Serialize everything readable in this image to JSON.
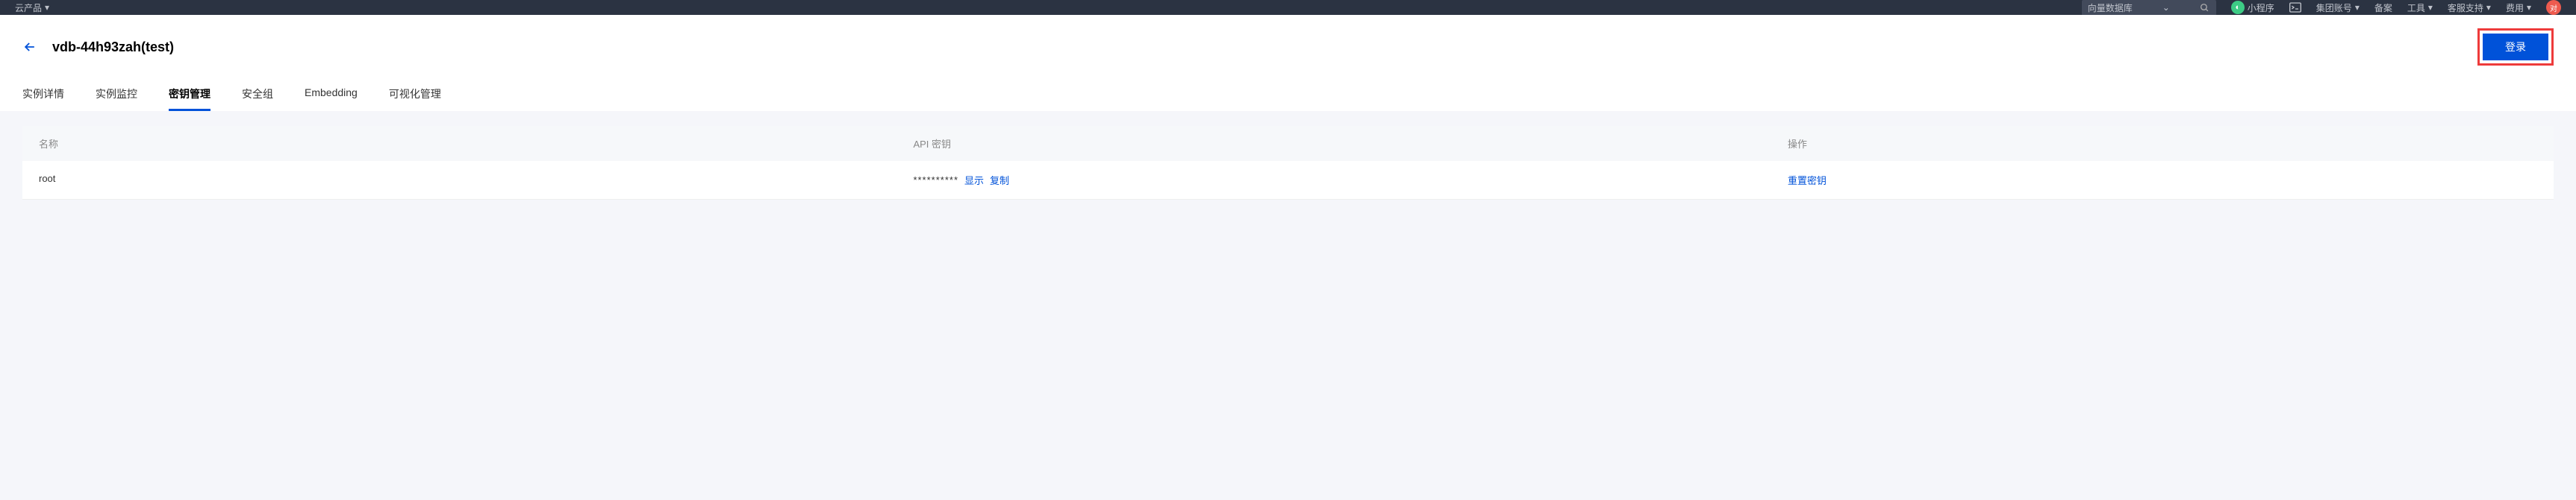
{
  "topnav": {
    "left_label": "云产品",
    "search_placeholder": "向量数据库",
    "miniprogram": "小程序",
    "group_account": "集团账号",
    "backup": "备案",
    "tools": "工具",
    "support": "客服支持",
    "cost": "费用",
    "avatar": "对"
  },
  "header": {
    "title": "vdb-44h93zah(test)",
    "login_button": "登录"
  },
  "tabs": {
    "detail": "实例详情",
    "monitor": "实例监控",
    "keys": "密钥管理",
    "security": "安全组",
    "embedding": "Embedding",
    "visual": "可视化管理"
  },
  "table": {
    "headers": {
      "name": "名称",
      "api_key": "API 密钥",
      "operation": "操作"
    },
    "row": {
      "name": "root",
      "masked_key": "**********",
      "show": "显示",
      "copy": "复制",
      "reset": "重置密钥"
    }
  }
}
